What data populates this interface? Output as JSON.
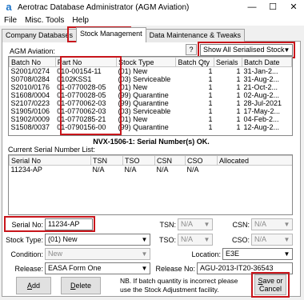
{
  "window": {
    "title": "Aerotrac Database Administrator (AGM Aviation)",
    "icon": "a",
    "minimize": "—",
    "maximize": "☐",
    "close": "✕"
  },
  "menu": [
    "File",
    "Misc. Tools",
    "Help"
  ],
  "tabs": [
    "Company Databases",
    "Stock Management",
    "Data Maintenance & Tweaks"
  ],
  "stock": {
    "section_label": "AGM Aviation:",
    "help_label": "?",
    "filter_value": "Show All Serialised Stock",
    "columns": [
      "Batch No",
      "Part No",
      "Stock Type",
      "Batch Qty",
      "Serials",
      "Batch Date"
    ],
    "rows": [
      [
        "S2001/0274",
        "010-00154-11",
        "(01) New",
        "1",
        "1",
        "31-Jan-2..."
      ],
      [
        "S0708/0284",
        "0102KSS1",
        "(03) Serviceable",
        "1",
        "1",
        "31-Aug-2..."
      ],
      [
        "S2010/0176",
        "01-0770028-05",
        "(01) New",
        "1",
        "1",
        "21-Oct-2..."
      ],
      [
        "S1608/0004",
        "01-0770028-05",
        "(99) Quarantine",
        "1",
        "1",
        "02-Aug-2..."
      ],
      [
        "S2107/0223",
        "01-0770062-03",
        "(99) Quarantine",
        "1",
        "1",
        "28-Jul-2021"
      ],
      [
        "S1905/0106",
        "01-0770062-03",
        "(03) Serviceable",
        "1",
        "1",
        "17-May-2..."
      ],
      [
        "S1902/0009",
        "01-0770285-21",
        "(01) New",
        "1",
        "1",
        "04-Feb-2..."
      ],
      [
        "S1508/0037",
        "01-0790156-00",
        "(99) Quarantine",
        "1",
        "1",
        "12-Aug-2..."
      ]
    ],
    "status_message": "NVX-1506-1: Serial Number(s) OK."
  },
  "serials": {
    "section_label": "Current Serial Number List:",
    "columns": [
      "Serial No",
      "TSN",
      "TSO",
      "CSN",
      "CSO",
      "Allocated"
    ],
    "rows": [
      [
        "11234-AP",
        "N/A",
        "N/A",
        "N/A",
        "N/A",
        ""
      ]
    ]
  },
  "form": {
    "serial_no_label": "Serial No:",
    "serial_no_value": "11234-AP",
    "tsn_label": "TSN:",
    "tsn_value": "N/A",
    "csn_label": "CSN:",
    "csn_value": "N/A",
    "stock_type_label": "Stock Type:",
    "stock_type_value": "(01) New",
    "tso_label": "TSO:",
    "tso_value": "N/A",
    "cso_label": "CSO:",
    "cso_value": "N/A",
    "condition_label": "Condition:",
    "condition_value": "New",
    "location_label": "Location:",
    "location_value": "E3E",
    "release_label": "Release:",
    "release_value": "EASA Form One",
    "release_no_label": "Release No:",
    "release_no_value": "AGU-2013-IT20-36543"
  },
  "buttons": {
    "add_accel": "A",
    "add_rest": "dd",
    "delete_accel": "D",
    "delete_rest": "elete",
    "save_line1_accel": "S",
    "save_line1_rest": "ave or",
    "save_line2": "Cancel"
  },
  "note_text": "NB. If batch quantity is incorrect please use the Stock Adjustment facility.",
  "colors": {
    "highlight_border": "#c8151b",
    "app_icon": "#1a73c8"
  }
}
